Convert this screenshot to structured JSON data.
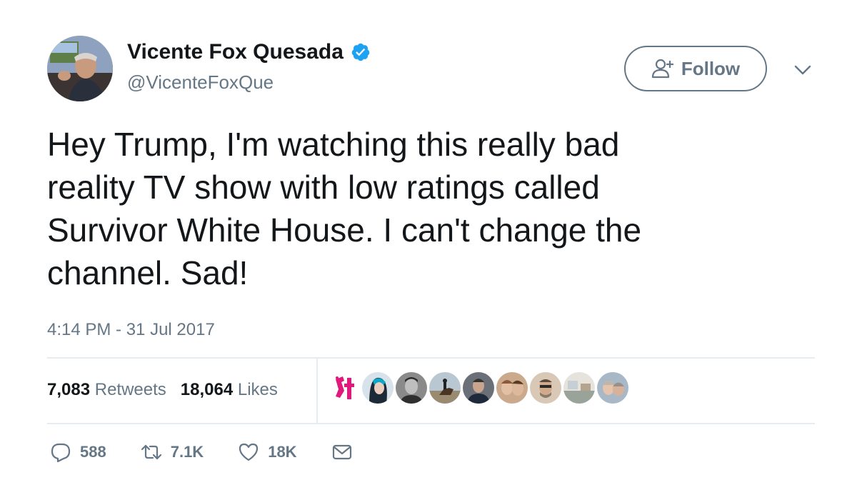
{
  "author": {
    "display_name": "Vicente Fox Quesada",
    "handle": "@VicenteFoxQue",
    "verified": true
  },
  "follow_button": {
    "label": "Follow"
  },
  "tweet": {
    "text": "Hey Trump, I'm watching this really bad\nreality TV show with low ratings called\nSurvivor White House. I can't change the\nchannel. Sad!",
    "timestamp": "4:14 PM - 31 Jul 2017"
  },
  "stats": {
    "retweets_count": "7,083",
    "retweets_label": "Retweets",
    "likes_count": "18,064",
    "likes_label": "Likes"
  },
  "actions": {
    "replies": "588",
    "retweets": "7.1K",
    "likes": "18K"
  },
  "colors": {
    "verified": "#1da1f2",
    "secondary_text": "#657786",
    "primary_text": "#14171a",
    "divider": "#e6ecf0"
  },
  "liker_avatars": [
    {
      "name": "liker-1"
    },
    {
      "name": "liker-2"
    },
    {
      "name": "liker-3"
    },
    {
      "name": "liker-4"
    },
    {
      "name": "liker-5"
    },
    {
      "name": "liker-6"
    },
    {
      "name": "liker-7"
    },
    {
      "name": "liker-8"
    },
    {
      "name": "liker-9"
    }
  ]
}
